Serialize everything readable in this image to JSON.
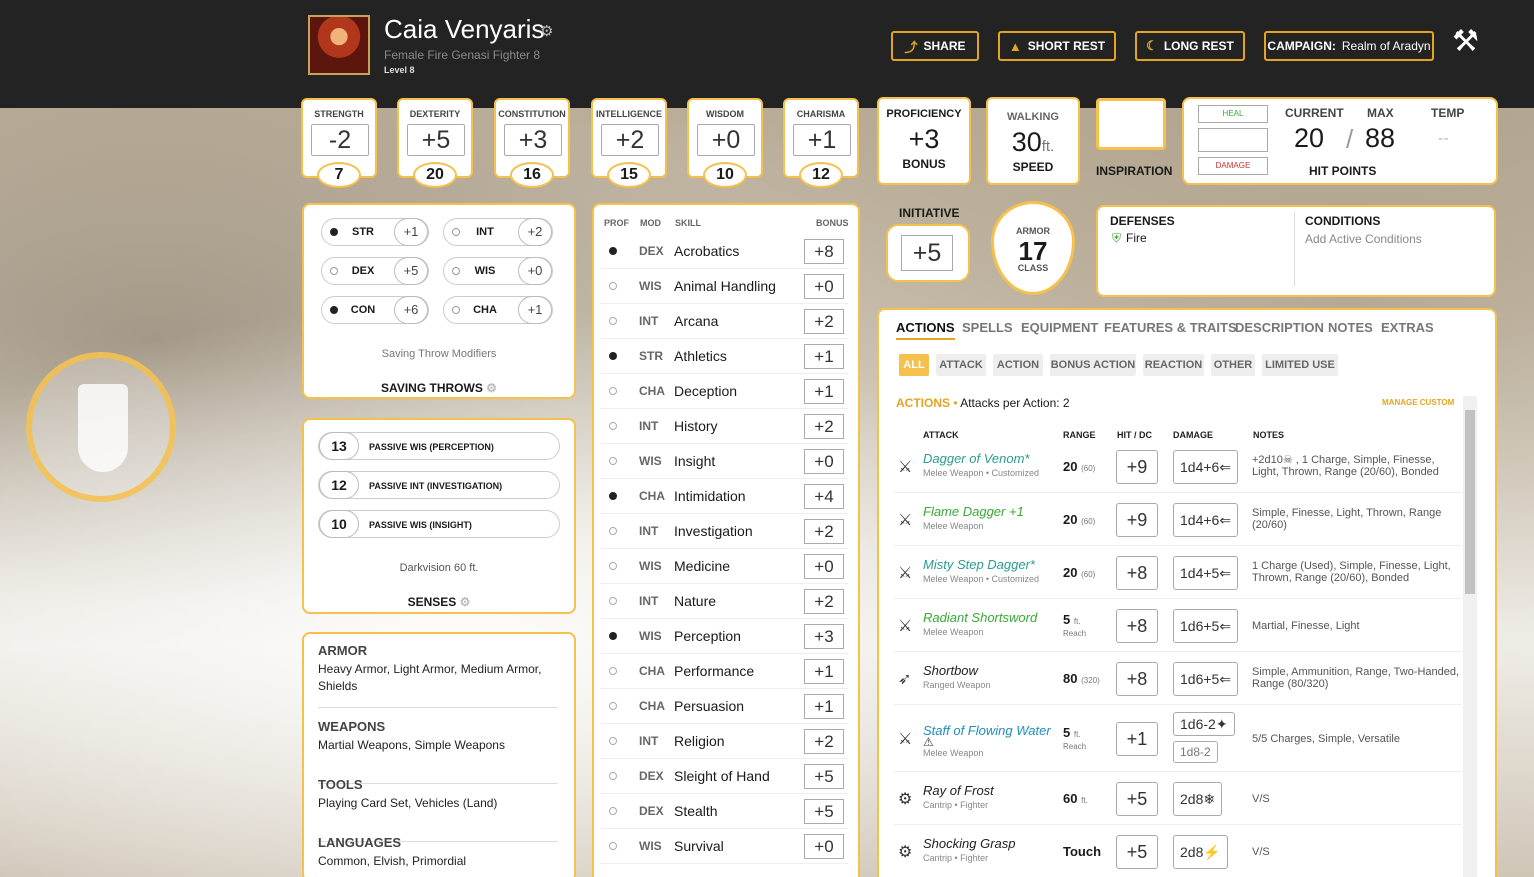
{
  "header": {
    "name": "Caia Venyaris",
    "subtitle": "Female  Fire Genasi  Fighter 8",
    "level": "Level 8",
    "buttons": {
      "share": "SHARE",
      "short_rest": "SHORT REST",
      "long_rest": "LONG REST",
      "campaign_label": "CAMPAIGN:",
      "campaign_value": "Realm of Aradyn"
    }
  },
  "abilities": [
    {
      "name": "STRENGTH",
      "mod": "-2",
      "score": "7"
    },
    {
      "name": "DEXTERITY",
      "mod": "+5",
      "score": "20"
    },
    {
      "name": "CONSTITUTION",
      "mod": "+3",
      "score": "16"
    },
    {
      "name": "INTELLIGENCE",
      "mod": "+2",
      "score": "15"
    },
    {
      "name": "WISDOM",
      "mod": "+0",
      "score": "10"
    },
    {
      "name": "CHARISMA",
      "mod": "+1",
      "score": "12"
    }
  ],
  "proficiency": {
    "title": "PROFICIENCY",
    "value": "+3",
    "sub": "BONUS"
  },
  "speed": {
    "title": "WALKING",
    "value": "30",
    "unit": "ft.",
    "sub": "SPEED"
  },
  "inspiration": {
    "label": "INSPIRATION"
  },
  "hp": {
    "heal": "HEAL",
    "damage": "DAMAGE",
    "current_label": "CURRENT",
    "max_label": "MAX",
    "temp_label": "TEMP",
    "current": "20",
    "sep": "/",
    "max": "88",
    "temp": "--",
    "title": "HIT POINTS"
  },
  "initiative": {
    "title": "INITIATIVE",
    "value": "+5"
  },
  "armor": {
    "top": "ARMOR",
    "value": "17",
    "bottom": "CLASS"
  },
  "defenses": {
    "title": "DEFENSES",
    "item": "Fire"
  },
  "conditions": {
    "title": "CONDITIONS",
    "placeholder": "Add Active Conditions"
  },
  "saves": [
    {
      "ab": "STR",
      "val": "+1",
      "prof": true
    },
    {
      "ab": "INT",
      "val": "+2",
      "prof": false
    },
    {
      "ab": "DEX",
      "val": "+5",
      "prof": false
    },
    {
      "ab": "WIS",
      "val": "+0",
      "prof": false
    },
    {
      "ab": "CON",
      "val": "+6",
      "prof": true
    },
    {
      "ab": "CHA",
      "val": "+1",
      "prof": false
    }
  ],
  "saving_throws": {
    "modifiers": "Saving Throw Modifiers",
    "title": "SAVING THROWS"
  },
  "senses": {
    "passives": [
      {
        "v": "13",
        "l": "PASSIVE WIS (PERCEPTION)"
      },
      {
        "v": "12",
        "l": "PASSIVE INT (INVESTIGATION)"
      },
      {
        "v": "10",
        "l": "PASSIVE WIS (INSIGHT)"
      }
    ],
    "darkvision": "Darkvision 60 ft.",
    "title": "SENSES"
  },
  "proficiencies": [
    {
      "h": "ARMOR",
      "t": "Heavy Armor, Light Armor, Medium Armor, Shields"
    },
    {
      "h": "WEAPONS",
      "t": "Martial Weapons, Simple Weapons"
    },
    {
      "h": "TOOLS",
      "t": "Playing Card Set, Vehicles (Land)"
    },
    {
      "h": "LANGUAGES",
      "t": "Common, Elvish, Primordial"
    }
  ],
  "skills_header": {
    "prof": "PROF",
    "mod": "MOD",
    "skill": "SKILL",
    "bonus": "BONUS"
  },
  "skills": [
    {
      "p": true,
      "m": "DEX",
      "n": "Acrobatics",
      "b": "+8"
    },
    {
      "p": false,
      "m": "WIS",
      "n": "Animal Handling",
      "b": "+0"
    },
    {
      "p": false,
      "m": "INT",
      "n": "Arcana",
      "b": "+2"
    },
    {
      "p": true,
      "m": "STR",
      "n": "Athletics",
      "b": "+1"
    },
    {
      "p": false,
      "m": "CHA",
      "n": "Deception",
      "b": "+1"
    },
    {
      "p": false,
      "m": "INT",
      "n": "History",
      "b": "+2"
    },
    {
      "p": false,
      "m": "WIS",
      "n": "Insight",
      "b": "+0"
    },
    {
      "p": true,
      "m": "CHA",
      "n": "Intimidation",
      "b": "+4"
    },
    {
      "p": false,
      "m": "INT",
      "n": "Investigation",
      "b": "+2"
    },
    {
      "p": false,
      "m": "WIS",
      "n": "Medicine",
      "b": "+0"
    },
    {
      "p": false,
      "m": "INT",
      "n": "Nature",
      "b": "+2"
    },
    {
      "p": true,
      "m": "WIS",
      "n": "Perception",
      "b": "+3"
    },
    {
      "p": false,
      "m": "CHA",
      "n": "Performance",
      "b": "+1"
    },
    {
      "p": false,
      "m": "CHA",
      "n": "Persuasion",
      "b": "+1"
    },
    {
      "p": false,
      "m": "INT",
      "n": "Religion",
      "b": "+2"
    },
    {
      "p": false,
      "m": "DEX",
      "n": "Sleight of Hand",
      "b": "+5"
    },
    {
      "p": false,
      "m": "DEX",
      "n": "Stealth",
      "b": "+5"
    },
    {
      "p": false,
      "m": "WIS",
      "n": "Survival",
      "b": "+0"
    }
  ],
  "tabs": [
    "ACTIONS",
    "SPELLS",
    "EQUIPMENT",
    "FEATURES & TRAITS",
    "DESCRIPTION",
    "NOTES",
    "EXTRAS"
  ],
  "filters": [
    "ALL",
    "ATTACK",
    "ACTION",
    "BONUS ACTION",
    "REACTION",
    "OTHER",
    "LIMITED USE"
  ],
  "actions": {
    "label": "ACTIONS",
    "sep": "•",
    "apa": "Attacks per Action: 2",
    "manage": "MANAGE CUSTOM",
    "cols": {
      "attack": "ATTACK",
      "range": "RANGE",
      "hit": "HIT / DC",
      "damage": "DAMAGE",
      "notes": "NOTES"
    },
    "rows": [
      {
        "name": "Dagger of Venom*",
        "type": "Melee Weapon • Customized",
        "range": "20",
        "range2": "(60)",
        "hit": "+9",
        "dmg": "1d4+6",
        "notes": "+2d10☠ , 1 Charge, Simple, Finesse, Light, Thrown, Range (20/60), Bonded"
      },
      {
        "name": "Flame Dagger +1",
        "type": "Melee Weapon",
        "range": "20",
        "range2": "(60)",
        "hit": "+9",
        "dmg": "1d4+6",
        "notes": "Simple, Finesse, Light, Thrown, Range (20/60)"
      },
      {
        "name": "Misty Step Dagger*",
        "type": "Melee Weapon • Customized",
        "range": "20",
        "range2": "(60)",
        "hit": "+8",
        "dmg": "1d4+5",
        "notes": "1 Charge (Used), Simple, Finesse, Light, Thrown, Range (20/60), Bonded"
      },
      {
        "name": "Radiant Shortsword",
        "type": "Melee Weapon",
        "range": "5",
        "range2": "ft.",
        "rr": "Reach",
        "hit": "+8",
        "dmg": "1d6+5",
        "notes": "Martial, Finesse, Light"
      },
      {
        "name": "Shortbow",
        "type": "Ranged Weapon",
        "range": "80",
        "range2": "(320)",
        "hit": "+8",
        "dmg": "1d6+5",
        "notes": "Simple, Ammunition, Range, Two-Handed, Range (80/320)"
      },
      {
        "name": "Staff of Flowing Water",
        "type": "Melee Weapon",
        "range": "5",
        "range2": "ft.",
        "rr": "Reach",
        "hit": "+1",
        "dmg": "1d6-2",
        "dmg2": "1d8-2",
        "notes": "5/5 Charges, Simple, Versatile"
      },
      {
        "name": "Ray of Frost",
        "type": "Cantrip • Fighter",
        "range": "60",
        "range2": "ft.",
        "hit": "+5",
        "dmg": "2d8",
        "notes": "V/S"
      },
      {
        "name": "Shocking Grasp",
        "type": "Cantrip • Fighter",
        "range": "Touch",
        "range2": "",
        "hit": "+5",
        "dmg": "2d8",
        "notes": "V/S"
      }
    ]
  }
}
